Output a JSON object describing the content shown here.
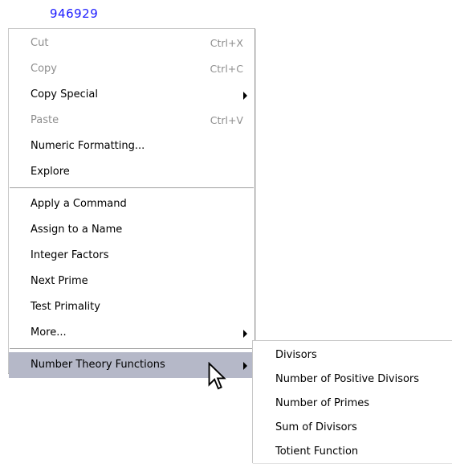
{
  "value": "946929",
  "context_menu": {
    "group1": [
      {
        "label": "Cut",
        "shortcut": "Ctrl+X",
        "enabled": false
      },
      {
        "label": "Copy",
        "shortcut": "Ctrl+C",
        "enabled": false
      },
      {
        "label": "Copy Special",
        "submenu": true,
        "enabled": true
      },
      {
        "label": "Paste",
        "shortcut": "Ctrl+V",
        "enabled": false
      },
      {
        "label": "Numeric Formatting...",
        "enabled": true
      },
      {
        "label": "Explore",
        "enabled": true
      }
    ],
    "group2": [
      {
        "label": "Apply a Command",
        "enabled": true
      },
      {
        "label": "Assign to a Name",
        "enabled": true
      },
      {
        "label": "Integer Factors",
        "enabled": true
      },
      {
        "label": "Next Prime",
        "enabled": true
      },
      {
        "label": "Test Primality",
        "enabled": true
      },
      {
        "label": "More...",
        "submenu": true,
        "enabled": true
      }
    ],
    "group3": [
      {
        "label": "Number Theory Functions",
        "submenu": true,
        "highlighted": true
      }
    ]
  },
  "submenu": {
    "items": [
      "Divisors",
      "Number of Positive Divisors",
      "Number of Primes",
      "Sum of Divisors",
      "Totient Function"
    ]
  },
  "colors": {
    "value_text": "#1a1aff",
    "highlight": "#b5b8c8",
    "disabled_text": "#8e8e8e"
  },
  "icons": {
    "cursor": "mouse-pointer-arrow-icon",
    "submenu_arrow": "triangle-right-icon"
  }
}
